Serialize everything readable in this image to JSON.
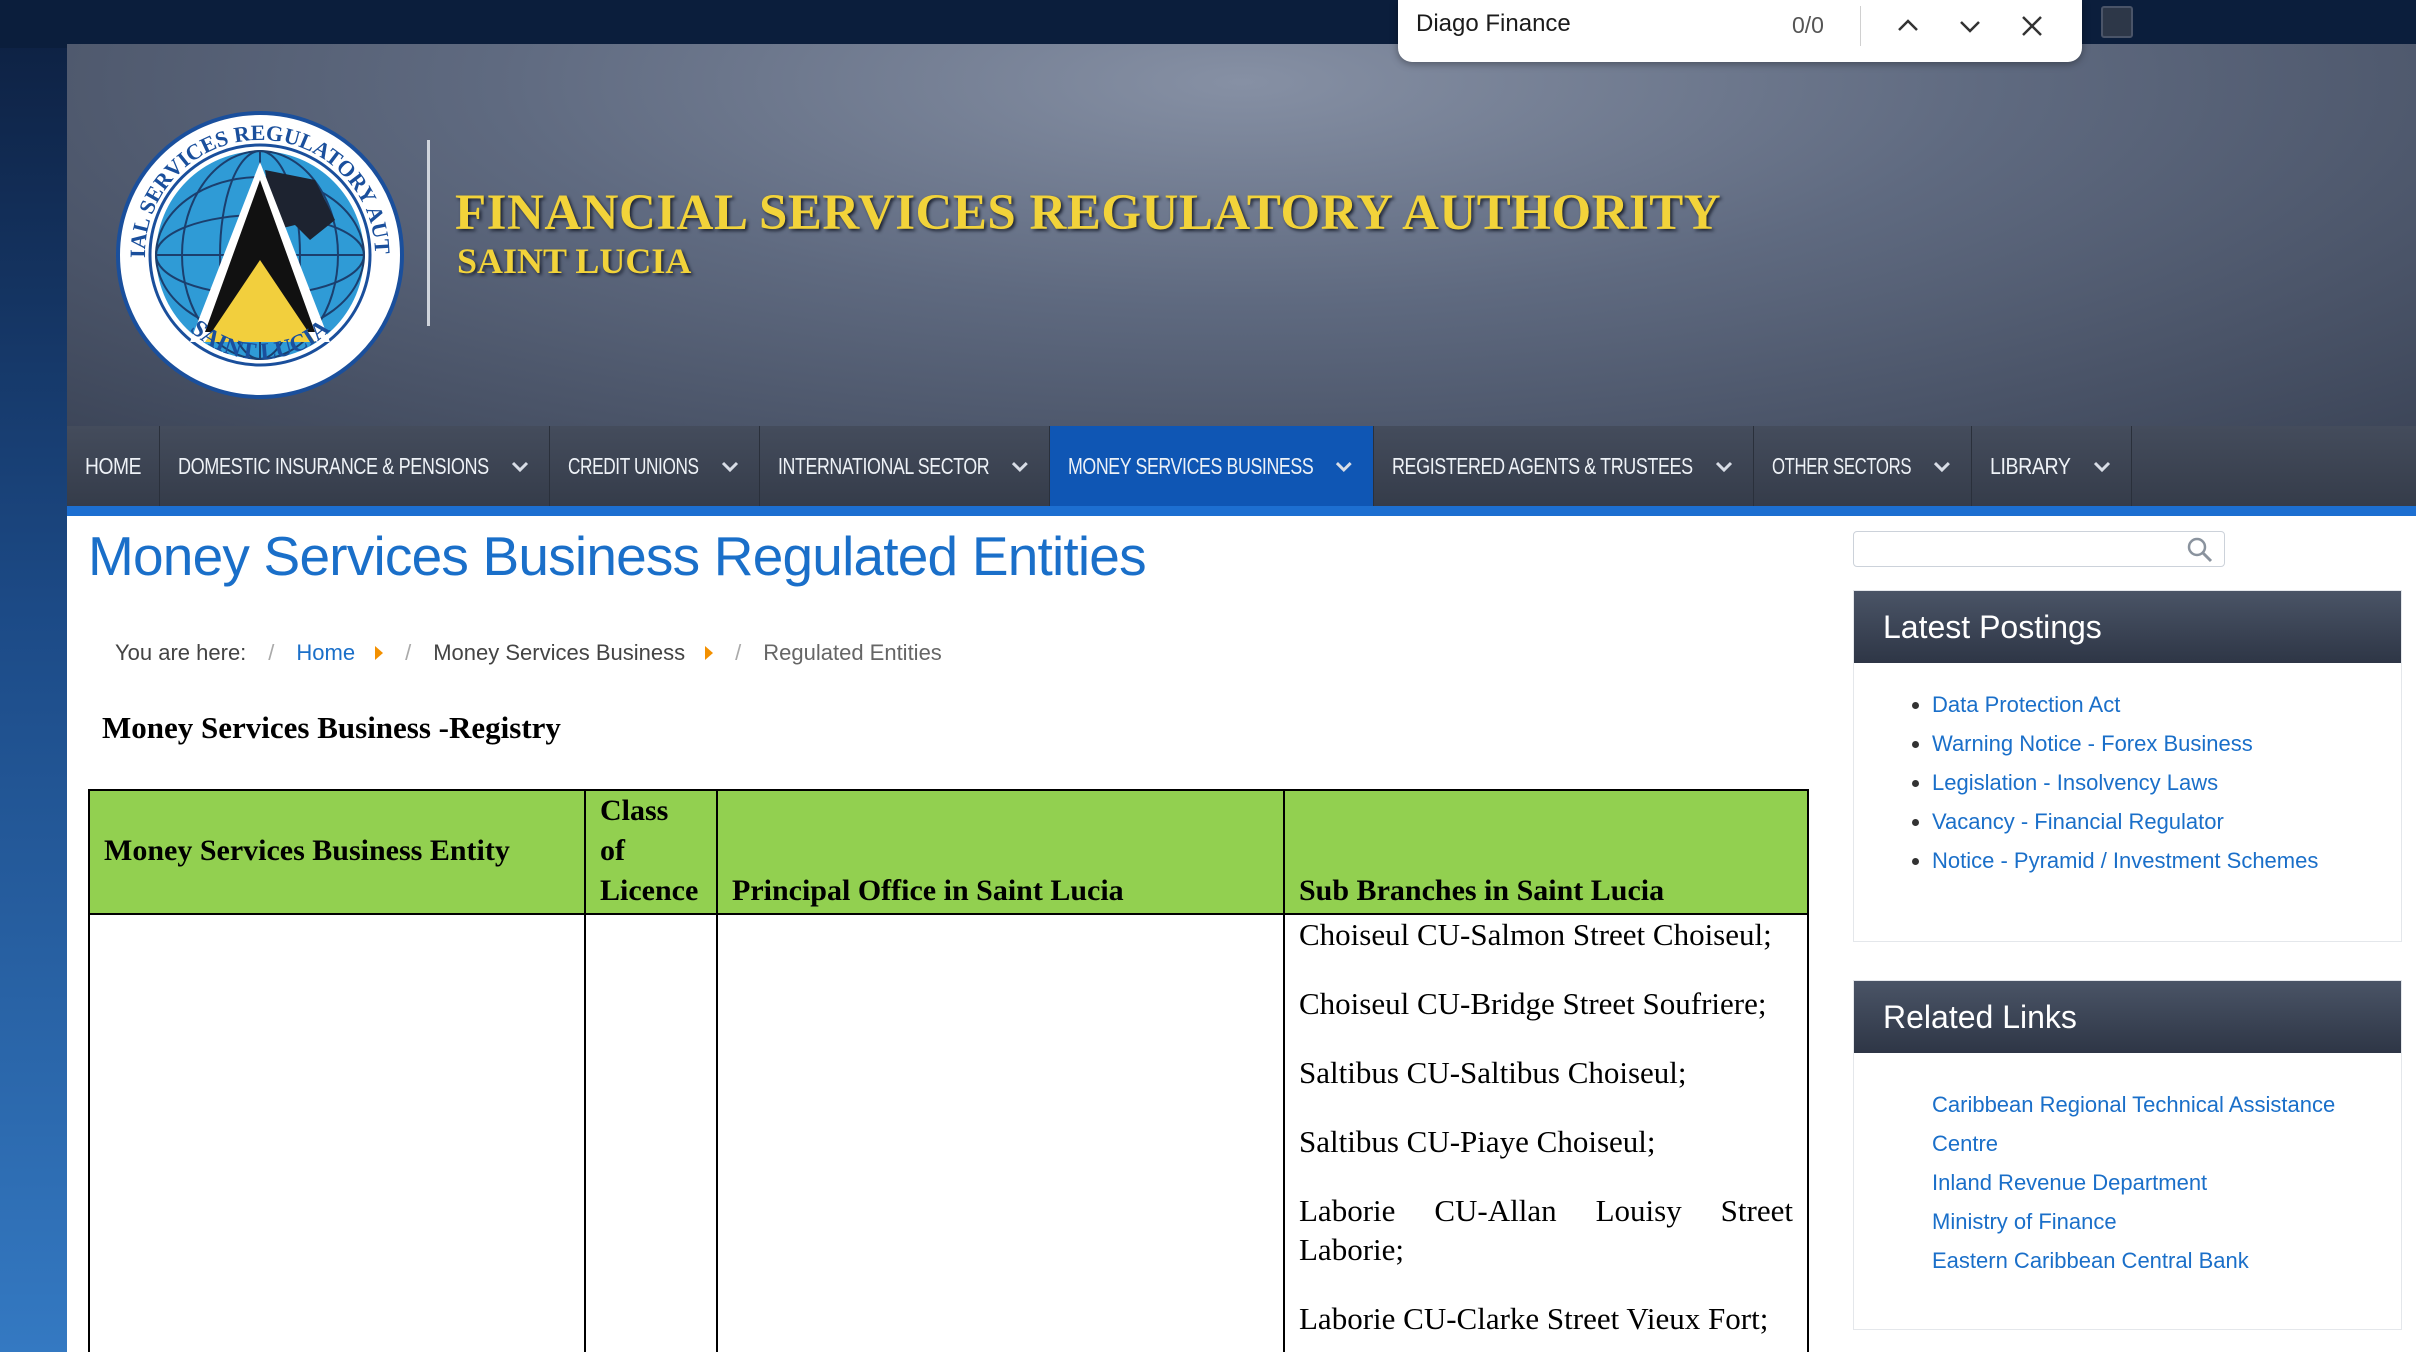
{
  "find_bar": {
    "query": "Diago Finance",
    "count": "0/0"
  },
  "site": {
    "title": "FINANCIAL SERVICES  REGULATORY AUTHORITY",
    "subtitle": "SAINT LUCIA",
    "logo_ring_top": "FINANCIAL SERVICES REGULATORY AUTHORITY",
    "logo_ring_bottom": "SAINT LUCIA"
  },
  "nav": {
    "items": [
      {
        "label": "HOME",
        "has_dropdown": false,
        "active": false
      },
      {
        "label": "DOMESTIC INSURANCE & PENSIONS",
        "has_dropdown": true,
        "active": false
      },
      {
        "label": "CREDIT UNIONS",
        "has_dropdown": true,
        "active": false
      },
      {
        "label": "INTERNATIONAL SECTOR",
        "has_dropdown": true,
        "active": false
      },
      {
        "label": "MONEY SERVICES BUSINESS",
        "has_dropdown": true,
        "active": true
      },
      {
        "label": "REGISTERED AGENTS & TRUSTEES",
        "has_dropdown": true,
        "active": false
      },
      {
        "label": "OTHER SECTORS",
        "has_dropdown": true,
        "active": false
      },
      {
        "label": "LIBRARY",
        "has_dropdown": true,
        "active": false
      }
    ]
  },
  "main": {
    "heading": "Money Services Business Regulated Entities",
    "breadcrumb": {
      "prefix": "You are here:",
      "home": "Home",
      "section": "Money Services Business",
      "current": "Regulated Entities"
    },
    "registry_title": "Money Services Business -Registry",
    "table": {
      "headers": {
        "entity": "Money Services Business Entity",
        "class_line1": "Class",
        "class_line2": "of",
        "class_line3": "Licence",
        "principal": "Principal Office in Saint Lucia",
        "branches": "Sub Branches in Saint Lucia"
      },
      "branches": [
        "Choiseul CU-Salmon Street Choiseul;",
        "Choiseul CU-Bridge Street Soufriere;",
        "Saltibus CU-Saltibus Choiseul;",
        "Saltibus CU-Piaye Choiseul;",
        "Laborie CU-Allan Louisy Street Laborie;",
        "Laborie CU-Clarke Street Vieux Fort;"
      ]
    }
  },
  "sidebar": {
    "latest_title": "Latest Postings",
    "latest": [
      "Data Protection Act",
      "Warning Notice - Forex Business",
      "Legislation - Insolvency Laws",
      "Vacancy - Financial Regulator",
      "Notice - Pyramid / Investment Schemes"
    ],
    "related_title": "Related Links",
    "related": [
      "Caribbean Regional Technical Assistance",
      "Centre",
      "Inland Revenue Department",
      "Ministry of Finance",
      "Eastern Caribbean Central Bank"
    ]
  },
  "colors": {
    "accent_blue": "#1a6fc9",
    "nav_active": "#0f56b4",
    "table_header": "#92d050",
    "title_gold": "#f2d33a"
  },
  "icons": {
    "search": "search-icon",
    "find_prev": "chevron-up-icon",
    "find_next": "chevron-down-icon",
    "find_close": "close-icon",
    "nav_dropdown": "chevron-down-icon",
    "breadcrumb_arrow": "triangle-right-icon"
  }
}
